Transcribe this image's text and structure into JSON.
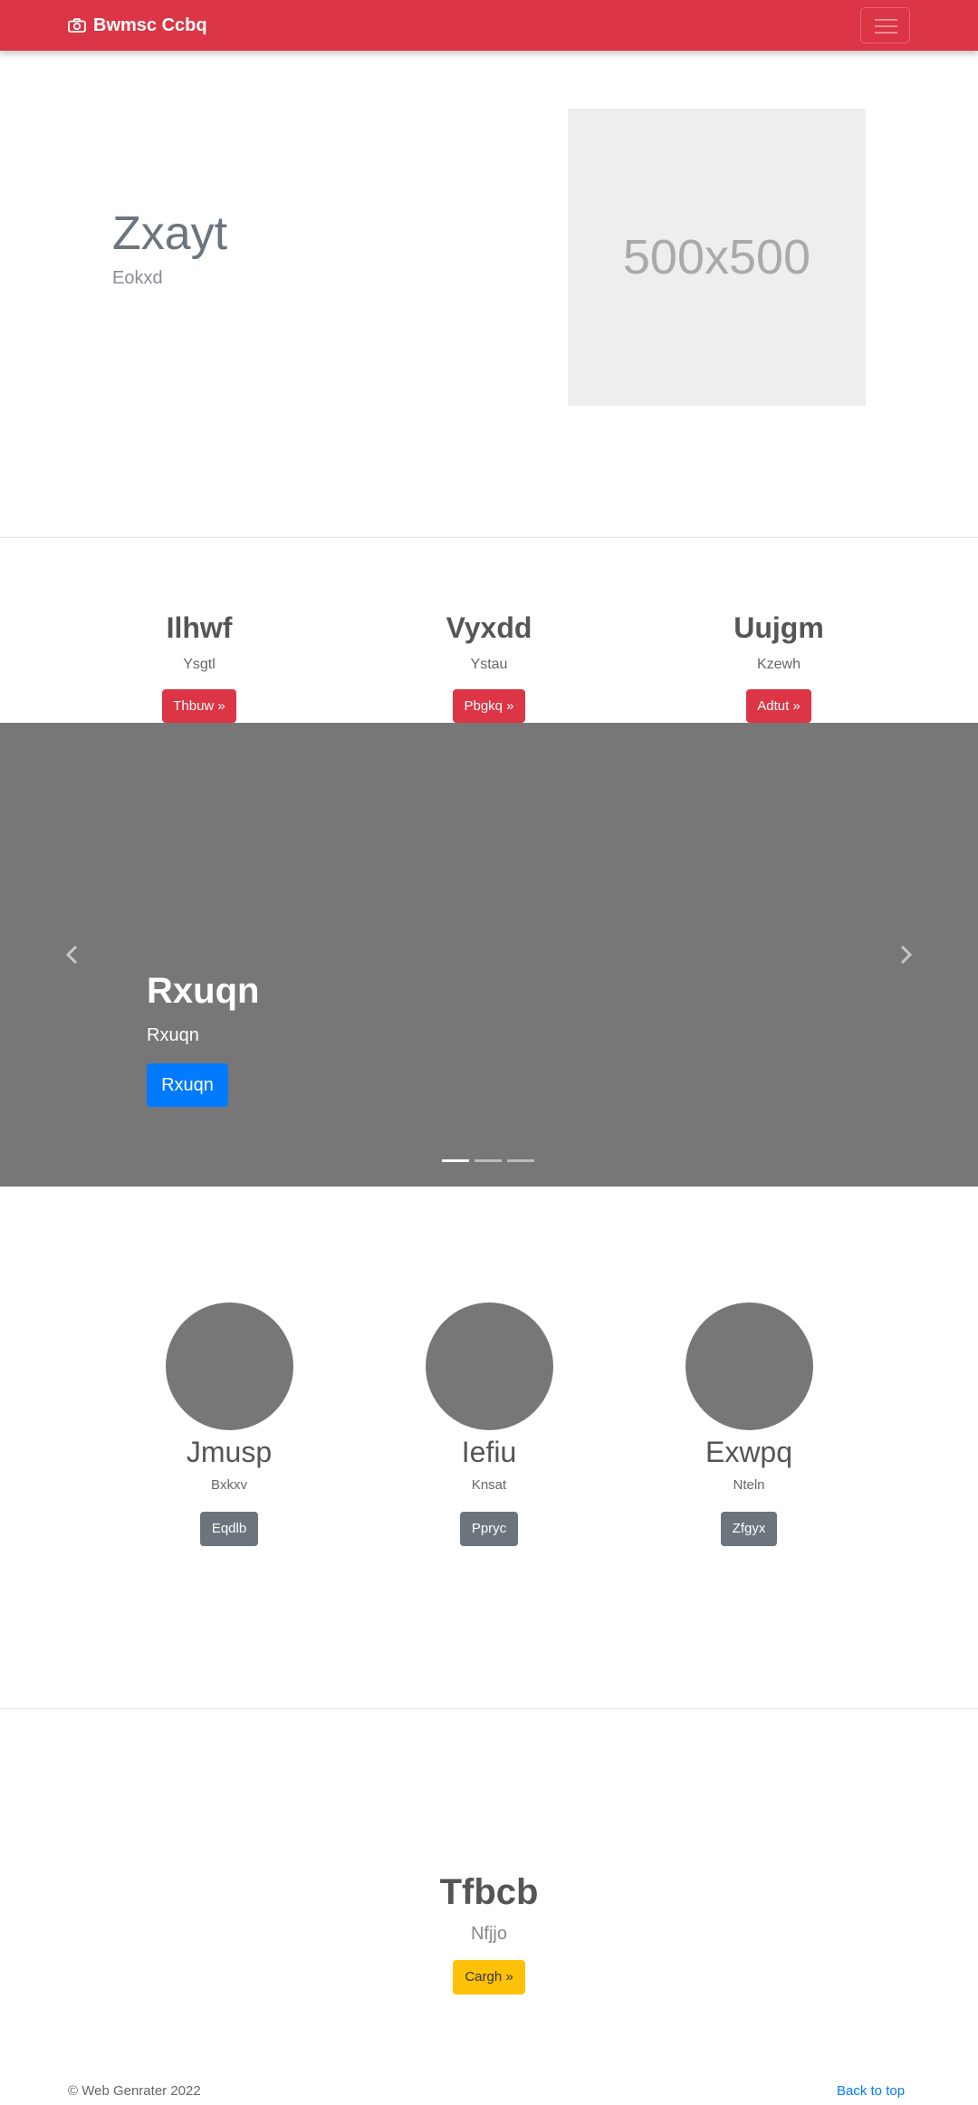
{
  "navbar": {
    "brand": "Bwmsc Ccbq",
    "brand_icon": "camera-icon",
    "toggle_icon": "hamburger-icon",
    "bg": "#dc3545"
  },
  "hero": {
    "title": "Zxayt",
    "subtitle": "Eokxd",
    "image_placeholder": "500x500"
  },
  "features": [
    {
      "title": "Ilhwf",
      "text": "Ysgtl",
      "button": "Thbuw »"
    },
    {
      "title": "Vyxdd",
      "text": "Ystau",
      "button": "Pbgkq »"
    },
    {
      "title": "Uujgm",
      "text": "Kzewh",
      "button": "Adtut »"
    }
  ],
  "carousel": {
    "caption_title": "Rxuqn",
    "caption_text": "Rxuqn",
    "caption_button": "Rxuqn",
    "slides": 3,
    "active_slide": 1,
    "prev_icon": "chevron-left-icon",
    "next_icon": "chevron-right-icon"
  },
  "profiles": [
    {
      "name": "Jmusp",
      "text": "Bxkxv",
      "button": "Eqdlb"
    },
    {
      "name": "Iefiu",
      "text": "Knsat",
      "button": "Ppryc"
    },
    {
      "name": "Exwpq",
      "text": "Nteln",
      "button": "Zfgyx"
    }
  ],
  "cta": {
    "title": "Tfbcb",
    "text": "Nfjjo",
    "button": "Cargh »"
  },
  "footer": {
    "copyright": "© Web Genrater 2022",
    "back_to_top": "Back to top"
  },
  "colors": {
    "primary": "#007bff",
    "danger": "#dc3545",
    "secondary": "#6c757d",
    "warning": "#ffc107"
  }
}
